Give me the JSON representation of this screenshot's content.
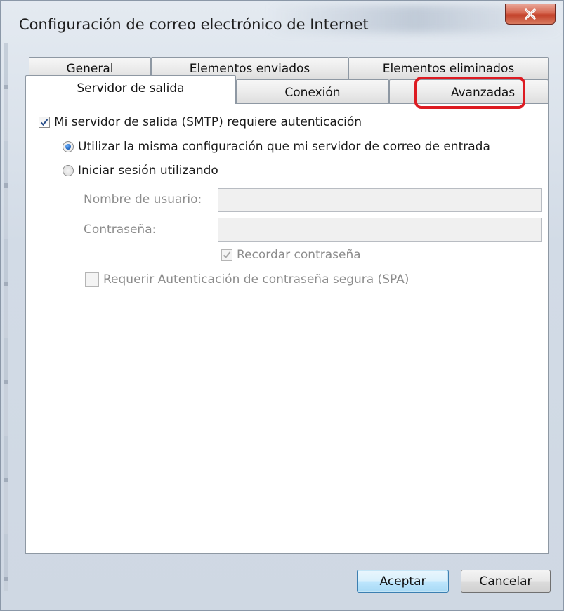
{
  "window": {
    "title": "Configuración de correo electrónico de Internet",
    "close_label": "X"
  },
  "tabs": {
    "back_row": [
      {
        "label": "General"
      },
      {
        "label": "Elementos enviados"
      },
      {
        "label": "Elementos eliminados"
      }
    ],
    "front_row": [
      {
        "label": "Servidor de salida",
        "active": true
      },
      {
        "label": "Conexión",
        "active": false
      },
      {
        "label": "Avanzadas",
        "active": false,
        "highlighted": true
      }
    ]
  },
  "outgoing_server": {
    "requires_auth": {
      "label": "Mi servidor de salida (SMTP) requiere autenticación",
      "checked": true
    },
    "use_same_settings": {
      "label": "Utilizar la misma configuración que mi servidor de correo de entrada",
      "selected": true
    },
    "login_using": {
      "label": "Iniciar sesión utilizando",
      "selected": false
    },
    "username": {
      "label": "Nombre de usuario:",
      "value": ""
    },
    "password": {
      "label": "Contraseña:",
      "value": ""
    },
    "remember_password": {
      "label": "Recordar contraseña",
      "checked": true,
      "enabled": false
    },
    "require_spa": {
      "label": "Requerir Autenticación de contraseña segura (SPA)",
      "checked": false,
      "enabled": false
    }
  },
  "buttons": {
    "ok": "Aceptar",
    "cancel": "Cancelar"
  },
  "colors": {
    "highlight": "#dd1b22",
    "close_button": "#c3412a",
    "radio_selected": "#1c5fb8"
  }
}
